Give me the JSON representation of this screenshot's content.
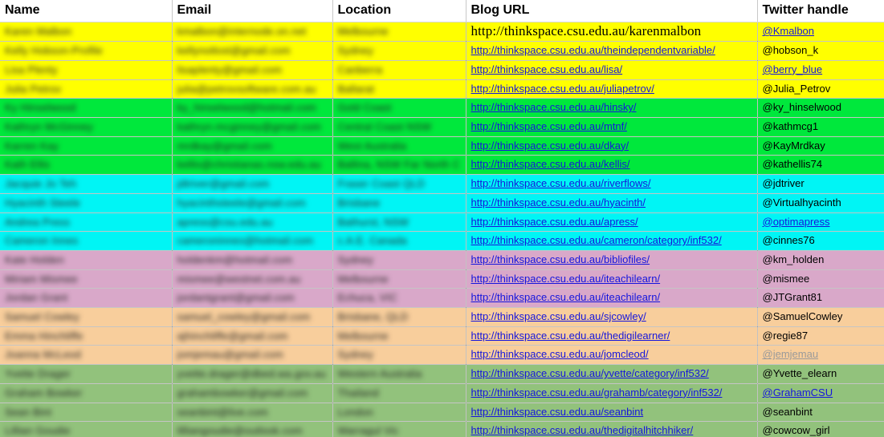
{
  "header": {
    "columns": [
      {
        "key": "name",
        "label": "Name"
      },
      {
        "key": "email",
        "label": "Email"
      },
      {
        "key": "loc",
        "label": "Location"
      },
      {
        "key": "blog",
        "label": "Blog URL"
      },
      {
        "key": "twitter",
        "label": "Twitter handle"
      }
    ]
  },
  "colors": {
    "yellow": "#FFFF00",
    "green": "#00E83C",
    "cyan": "#00F5F5",
    "plum": "#D9A8C9",
    "peach": "#F8CE9C",
    "sage": "#92C27C",
    "link": "#1515DD",
    "link_visited": "#9A9A9A",
    "header_bg": "#FFFFFF",
    "grid": "#787878"
  },
  "rows": [
    {
      "band": "yellow",
      "name": "Karen Malbon",
      "email": "kmalbon@internode.on.net",
      "loc": "Melbourne",
      "blog": "http://thinkspace.csu.edu.au/karenmalbon",
      "blog_style": "serif-plain",
      "twitter": "@Kmalbon",
      "twitter_style": "link"
    },
    {
      "band": "yellow",
      "name": "Kelly Hobson-Profile",
      "email": "kellynotlost@gmail.com",
      "loc": "Sydney",
      "blog": "http://thinkspace.csu.edu.au/theindependentvariable/",
      "blog_style": "link",
      "twitter": "@hobson_k",
      "twitter_style": "plain"
    },
    {
      "band": "yellow",
      "name": "Lisa Plenty",
      "email": "lisaplenty@gmail.com",
      "loc": "Canberra",
      "blog": "http://thinkspace.csu.edu.au/lisa/",
      "blog_style": "link",
      "twitter": "@berry_blue",
      "twitter_style": "link"
    },
    {
      "band": "yellow",
      "name": "Julia Petrov",
      "email": "julia@petrovsoftware.com.au",
      "loc": "Ballarat",
      "blog": "http://thinkspace.csu.edu.au/juliapetrov/",
      "blog_style": "link",
      "twitter": "@Julia_Petrov",
      "twitter_style": "plain"
    },
    {
      "band": "green",
      "name": "Ky Hinselwood",
      "email": "ky_hinselwood@hotmail.com",
      "loc": "Gold Coast",
      "blog": "http://thinkspace.csu.edu.au/hinsky/",
      "blog_style": "link",
      "twitter": "@ky_hinselwood",
      "twitter_style": "plain"
    },
    {
      "band": "green",
      "name": "Kathryn McGinney",
      "email": "kathryn.mcginney@gmail.com",
      "loc": "Central Coast NSW",
      "blog": "http://thinkspace.csu.edu.au/mtnf/",
      "blog_style": "link",
      "twitter": "@kathmcg1",
      "twitter_style": "plain"
    },
    {
      "band": "green",
      "name": "Karren Kay",
      "email": "mrdkay@gmail.com",
      "loc": "West Australia",
      "blog": "http://thinkspace.csu.edu.au/dkay/",
      "blog_style": "link",
      "twitter": "@KayMrdkay",
      "twitter_style": "plain"
    },
    {
      "band": "green",
      "name": "Kath Ellis",
      "email": "kellis@christianas.nsw.edu.au",
      "loc": "Ballina, NSW Far North C",
      "blog": "http://thinkspace.csu.edu.au/kellis/",
      "blog_style": "link",
      "twitter": "@kathellis74",
      "twitter_style": "plain"
    },
    {
      "band": "cyan",
      "name": "Jacquie Jo Teh",
      "email": "jdtriver@gmail.com",
      "loc": "Fraser Coast  QLD",
      "blog": "http://thinkspace.csu.edu.au/riverflows/",
      "blog_style": "link",
      "twitter": "@jdtriver",
      "twitter_style": "plain"
    },
    {
      "band": "cyan",
      "name": "Hyacinth Steele",
      "email": "hyacinthsteele@gmail.com",
      "loc": "Brisbane",
      "blog": "http://thinkspace.csu.edu.au/hyacinth/",
      "blog_style": "link",
      "twitter": "@Virtualhyacinth",
      "twitter_style": "plain"
    },
    {
      "band": "cyan",
      "name": "Andrea Press",
      "email": "apress@csu.edu.au",
      "loc": "Bathurst, NSW",
      "blog": "http://thinkspace.csu.edu.au/apress/",
      "blog_style": "link",
      "twitter": "@optimapress",
      "twitter_style": "link"
    },
    {
      "band": "cyan",
      "name": "Cameron Innes",
      "email": "cameroninnes@hotmail.com",
      "loc": "c.A.E. Canada",
      "blog": "http://thinkspace.csu.edu.au/cameron/category/inf532/",
      "blog_style": "link",
      "twitter": "@cinnes76",
      "twitter_style": "plain"
    },
    {
      "band": "plum",
      "name": "Kate Holden",
      "email": "holdenkm@hotmail.com",
      "loc": "Sydney",
      "blog": "http://thinkspace.csu.edu.au/bibliofiles/",
      "blog_style": "link",
      "twitter": "@km_holden",
      "twitter_style": "plain"
    },
    {
      "band": "plum",
      "name": "Miriam Mismee",
      "email": "mismee@westnet.com.au",
      "loc": "Melbourne",
      "blog": "http://thinkspace.csu.edu.au/iteachilearn/",
      "blog_style": "link",
      "twitter": "@mismee",
      "twitter_style": "plain"
    },
    {
      "band": "plum",
      "name": "Jordan Grant",
      "email": "jordantgrant@gmail.com",
      "loc": "Echuca, VIC",
      "blog": "http://thinkspace.csu.edu.au/iteachilearn/",
      "blog_style": "link",
      "twitter": "@JTGrant81",
      "twitter_style": "plain"
    },
    {
      "band": "peach",
      "name": "Samuel Cowley",
      "email": "samuel_cowley@gmail.com",
      "loc": "Brisbane, QLD",
      "blog": "http://thinkspace.csu.edu.au/sjcowley/",
      "blog_style": "link",
      "twitter": "@SamuelCowley",
      "twitter_style": "plain"
    },
    {
      "band": "peach",
      "name": "Emma Hinchliffe",
      "email": "ajhinchliffe@gmail.com",
      "loc": "Melbourne",
      "blog": "http://thinkspace.csu.edu.au/thedigilearner/",
      "blog_style": "link",
      "twitter": "@regie87",
      "twitter_style": "plain"
    },
    {
      "band": "peach",
      "name": "Joanna McLeod",
      "email": "jomjemau@gmail.com",
      "loc": "Sydney",
      "blog": "http://thinkspace.csu.edu.au/jomcleod/",
      "blog_style": "link",
      "twitter": "@jemjemau",
      "twitter_style": "link-visited"
    },
    {
      "band": "sage",
      "name": "Yvette Drager",
      "email": "yvette.drager@dbed.wa.gov.au",
      "loc": "Western Australia",
      "blog": "http://thinkspace.csu.edu.au/yvette/category/inf532/",
      "blog_style": "link",
      "twitter": "@Yvette_elearn",
      "twitter_style": "plain"
    },
    {
      "band": "sage",
      "name": "Graham Bowker",
      "email": "grahambowker@gmail.com",
      "loc": "Thailand",
      "blog": "http://thinkspace.csu.edu.au/grahamb/category/inf532/",
      "blog_style": "link",
      "twitter": "@GrahamCSU",
      "twitter_style": "link"
    },
    {
      "band": "sage",
      "name": "Sean Bint",
      "email": "seanbint@live.com",
      "loc": "London",
      "blog": "http://thinkspace.csu.edu.au/seanbint",
      "blog_style": "link",
      "twitter": "@seanbint",
      "twitter_style": "plain"
    },
    {
      "band": "sage",
      "name": "Lillian Goudie",
      "email": "lilliangoudie@outlook.com",
      "loc": "Warragul  Vic",
      "blog": "http://thinkspace.csu.edu.au/thedigitalhitchhiker/",
      "blog_style": "link",
      "twitter": "@cowcow_girl",
      "twitter_style": "plain"
    }
  ]
}
